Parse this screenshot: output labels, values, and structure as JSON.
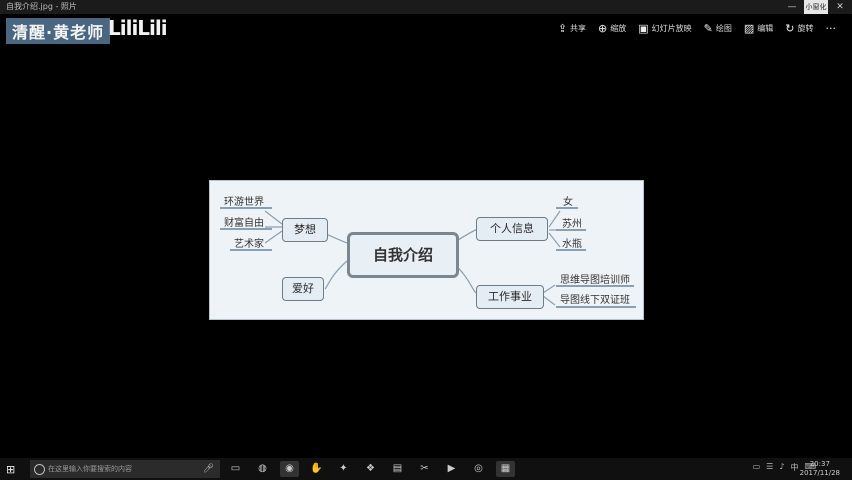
{
  "window": {
    "title": "自我介绍.jpg - 照片",
    "controls": {
      "minimize": "—",
      "restore": "小窗化",
      "close": "✕"
    }
  },
  "watermark": {
    "text": "清醒·黄老师",
    "brand": "LiliLili"
  },
  "toolbar": {
    "items": [
      {
        "label": "共享",
        "icon": "share-icon"
      },
      {
        "label": "缩放",
        "icon": "zoom-icon"
      },
      {
        "label": "幻灯片放映",
        "icon": "slideshow-icon"
      },
      {
        "label": "绘图",
        "icon": "draw-icon"
      },
      {
        "label": "编辑",
        "icon": "edit-icon"
      },
      {
        "label": "旋转",
        "icon": "rotate-icon"
      }
    ],
    "more": "···"
  },
  "mindmap": {
    "center": "自我介绍",
    "left_branches": [
      {
        "label": "梦想",
        "children": [
          "环游世界",
          "财富自由",
          "艺术家"
        ]
      },
      {
        "label": "爱好",
        "children": []
      }
    ],
    "right_branches": [
      {
        "label": "个人信息",
        "children": [
          "女",
          "苏州",
          "水瓶"
        ]
      },
      {
        "label": "工作事业",
        "children": [
          "思维导图培训师",
          "导图线下双证班"
        ]
      }
    ]
  },
  "taskbar": {
    "search_placeholder": "在这里输入你要搜索的内容",
    "tray": "中",
    "time": "20:37",
    "date": "2017/11/28"
  },
  "colors": {
    "canvas": "#000000",
    "mindmap_bg": "#eef3f7",
    "watermark_bg": "#4a6782"
  }
}
